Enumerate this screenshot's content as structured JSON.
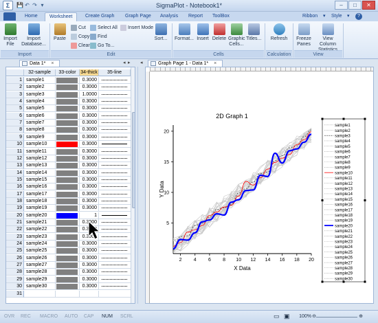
{
  "window": {
    "title": "SigmaPlot - Notebook1*",
    "app_icon": "Σ",
    "qat": [
      "💾",
      "↶",
      "↷",
      "▾"
    ],
    "buttons": [
      "–",
      "□",
      "✕"
    ]
  },
  "ribbon_tabs": [
    "Home",
    "Worksheet",
    "Create Graph",
    "Graph Page",
    "Analysis",
    "Report",
    "ToolBox"
  ],
  "active_tab": "Worksheet",
  "file_tab_label": "",
  "tab_right": {
    "ribbon": "Ribbon",
    "style": "Style",
    "help": "?"
  },
  "ribbon": {
    "import_group": {
      "label": "Import",
      "import_file": "Import File",
      "import_database": "Import Database..."
    },
    "edit_group": {
      "label": "Edit",
      "paste": "Paste",
      "cut": "Cut",
      "copy": "Copy",
      "clear": "Clear",
      "select_all": "Select All",
      "find": "Find",
      "goto": "Go To...",
      "insert_mode": "Insert Mode",
      "sort": "Sort..."
    },
    "cells_group": {
      "label": "Cells",
      "format": "Format...",
      "insert": "Insert",
      "delete": "Delete",
      "graphic_cells": "Graphic Cells...",
      "titles": "Titles..."
    },
    "calc_group": {
      "label": "Calculation",
      "refresh": "Refresh"
    },
    "view_group": {
      "label": "View",
      "freeze_panes": "Freeze Panes",
      "view_column_stats": "View Column Statistics"
    }
  },
  "data_tab": "Data 1*",
  "graph_tab": "Graph Page 1 - Data 1*",
  "worksheet": {
    "columns": [
      "32-sample",
      "33-color",
      "34-thick",
      "35-line"
    ],
    "rows": [
      {
        "n": "1",
        "sample": "sample1",
        "color": "#808080",
        "thick": "0.3000",
        "line": "dotted"
      },
      {
        "n": "2",
        "sample": "sample2",
        "color": "#808080",
        "thick": "0.3000",
        "line": "dotted"
      },
      {
        "n": "3",
        "sample": "sample3",
        "color": "#808080",
        "thick": "1.0000",
        "line": "dotted"
      },
      {
        "n": "4",
        "sample": "sample4",
        "color": "#808080",
        "thick": "0.3000",
        "line": "dotted"
      },
      {
        "n": "5",
        "sample": "sample5",
        "color": "#808080",
        "thick": "0.3000",
        "line": "dotted"
      },
      {
        "n": "6",
        "sample": "sample6",
        "color": "#808080",
        "thick": "0.3000",
        "line": "dotted"
      },
      {
        "n": "7",
        "sample": "sample7",
        "color": "#808080",
        "thick": "0.3000",
        "line": "dotted"
      },
      {
        "n": "8",
        "sample": "sample8",
        "color": "#808080",
        "thick": "0.3000",
        "line": "dotted"
      },
      {
        "n": "9",
        "sample": "sample9",
        "color": "#808080",
        "thick": "0.3000",
        "line": "dotted"
      },
      {
        "n": "10",
        "sample": "sample10",
        "color": "#ff0000",
        "thick": "0.3000",
        "line": "solid"
      },
      {
        "n": "11",
        "sample": "sample11",
        "color": "#808080",
        "thick": "0.3000",
        "line": "dotted"
      },
      {
        "n": "12",
        "sample": "sample12",
        "color": "#808080",
        "thick": "0.3000",
        "line": "dotted"
      },
      {
        "n": "13",
        "sample": "sample13",
        "color": "#808080",
        "thick": "0.3000",
        "line": "dotted"
      },
      {
        "n": "14",
        "sample": "sample14",
        "color": "#808080",
        "thick": "0.3000",
        "line": "dotted"
      },
      {
        "n": "15",
        "sample": "sample15",
        "color": "#808080",
        "thick": "0.3000",
        "line": "dotted"
      },
      {
        "n": "16",
        "sample": "sample16",
        "color": "#808080",
        "thick": "0.3000",
        "line": "dotted"
      },
      {
        "n": "17",
        "sample": "sample17",
        "color": "#808080",
        "thick": "0.3000",
        "line": "dotted"
      },
      {
        "n": "18",
        "sample": "sample18",
        "color": "#808080",
        "thick": "0.3000",
        "line": "dotted"
      },
      {
        "n": "19",
        "sample": "sample19",
        "color": "#808080",
        "thick": "0.3000",
        "line": "dotted"
      },
      {
        "n": "20",
        "sample": "sample20",
        "color": "#0000ff",
        "thick": "1",
        "line": "solid"
      },
      {
        "n": "21",
        "sample": "sample21",
        "color": "#808080",
        "thick": "0.3000",
        "line": "dotted"
      },
      {
        "n": "22",
        "sample": "sample22",
        "color": "#808080",
        "thick": "0.3000",
        "line": "dotted"
      },
      {
        "n": "23",
        "sample": "sample23",
        "color": "#808080",
        "thick": "0.3000",
        "line": "dotted"
      },
      {
        "n": "24",
        "sample": "sample24",
        "color": "#808080",
        "thick": "0.3000",
        "line": "dotted"
      },
      {
        "n": "25",
        "sample": "sample25",
        "color": "#808080",
        "thick": "0.3000",
        "line": "dotted"
      },
      {
        "n": "26",
        "sample": "sample26",
        "color": "#808080",
        "thick": "0.3000",
        "line": "dotted"
      },
      {
        "n": "27",
        "sample": "sample27",
        "color": "#808080",
        "thick": "0.3000",
        "line": "dotted"
      },
      {
        "n": "28",
        "sample": "sample28",
        "color": "#808080",
        "thick": "0.3000",
        "line": "dotted"
      },
      {
        "n": "29",
        "sample": "sample29",
        "color": "#808080",
        "thick": "0.3000",
        "line": "dotted"
      },
      {
        "n": "30",
        "sample": "sample30",
        "color": "#808080",
        "thick": "0.3000",
        "line": "dotted"
      },
      {
        "n": "31",
        "sample": "",
        "color": "",
        "thick": "",
        "line": ""
      }
    ]
  },
  "chart_data": {
    "type": "line",
    "title": "2D Graph 1",
    "xlabel": "X Data",
    "ylabel": "Y Data",
    "xlim": [
      1,
      20
    ],
    "ylim": [
      0,
      21
    ],
    "xticks": [
      "2",
      "4",
      "6",
      "8",
      "10",
      "12",
      "14",
      "16",
      "18",
      "20"
    ],
    "yticks": [
      "5",
      "10",
      "15",
      "20"
    ],
    "legend": [
      "sample1",
      "sample2",
      "sample3",
      "sample4",
      "sample5",
      "sample6",
      "sample7",
      "sample8",
      "sample9",
      "sample10",
      "sample11",
      "sample12",
      "sample13",
      "sample14",
      "sample15",
      "sample16",
      "sample17",
      "sample18",
      "sample19",
      "sample20",
      "sample21",
      "sample22",
      "sample23",
      "sample24",
      "sample25",
      "sample26",
      "sample27",
      "sample28",
      "sample29",
      "sample30"
    ],
    "legend_position": "right",
    "highlight": {
      "sample20": {
        "color": "#0000ff"
      },
      "sample10": {
        "color": "#ff0000"
      },
      "sample3": {
        "color": "#555555"
      }
    },
    "series": [
      {
        "name": "sample20",
        "x": [
          1,
          2,
          3,
          4,
          5,
          6,
          7,
          8,
          9,
          10,
          11,
          12,
          13,
          14,
          15,
          16,
          17,
          18,
          19,
          20
        ],
        "y": [
          0.8,
          2.3,
          2.2,
          3.4,
          5.2,
          5.5,
          6.5,
          6.3,
          8.4,
          8.8,
          10.3,
          10.4,
          12.8,
          12.6,
          16.4,
          14.8,
          16.8,
          17.1,
          18.2,
          19.5
        ]
      },
      {
        "name": "sample10",
        "x": [
          1,
          2,
          3,
          4,
          5,
          6,
          7,
          8,
          9,
          10,
          11,
          12,
          13,
          14,
          15,
          16,
          17,
          18,
          19,
          20
        ],
        "y": [
          1.2,
          1.8,
          3.5,
          3.9,
          4.6,
          6.2,
          6.8,
          7.6,
          7.9,
          9.4,
          11.8,
          11.2,
          12.4,
          13.8,
          14.9,
          15.6,
          16.2,
          17.8,
          18.6,
          19.9
        ]
      },
      {
        "name": "sample3",
        "x": [
          1,
          2,
          3,
          4,
          5,
          6,
          7,
          8,
          9,
          10,
          11,
          12,
          13,
          14,
          15,
          16,
          17,
          18,
          19,
          20
        ],
        "y": [
          0.6,
          2.8,
          2.9,
          4.6,
          5.0,
          5.9,
          7.2,
          7.5,
          8.0,
          9.9,
          10.6,
          11.7,
          13.1,
          13.3,
          15.2,
          16.0,
          17.3,
          17.6,
          19.1,
          20.2
        ]
      }
    ]
  },
  "status": {
    "items": [
      "OVR",
      "REC",
      "MACRO",
      "AUTO",
      "CAP",
      "NUM",
      "SCRL"
    ],
    "active": [
      "NUM"
    ],
    "zoom": "100%"
  }
}
